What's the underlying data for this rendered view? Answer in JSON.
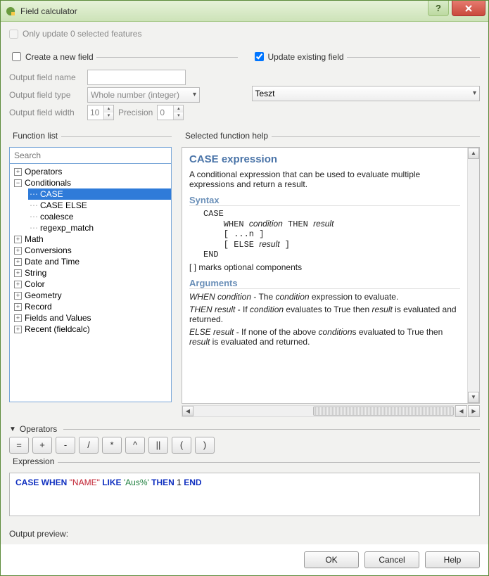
{
  "window": {
    "title": "Field calculator"
  },
  "checkboxes": {
    "only_update": "Only update 0 selected features",
    "create_new_field": "Create a new field",
    "update_existing_field": "Update existing field"
  },
  "form": {
    "output_name_label": "Output field name",
    "output_type_label": "Output field type",
    "output_type_value": "Whole number (integer)",
    "output_width_label": "Output field width",
    "output_width_value": "10",
    "precision_label": "Precision",
    "precision_value": "0",
    "existing_field_value": "Teszt"
  },
  "sections": {
    "function_list": "Function list",
    "selected_help": "Selected function help",
    "operators": "Operators",
    "expression": "Expression",
    "output_preview": "Output preview:"
  },
  "search_placeholder": "Search",
  "tree": {
    "top": [
      "Operators",
      "Conditionals",
      "Math",
      "Conversions",
      "Date and Time",
      "String",
      "Color",
      "Geometry",
      "Record",
      "Fields and Values",
      "Recent (fieldcalc)"
    ],
    "conditionals_children": [
      "CASE",
      "CASE ELSE",
      "coalesce",
      "regexp_match"
    ],
    "selected": "CASE"
  },
  "help": {
    "title": "CASE expression",
    "intro": "A conditional expression that can be used to evaluate multiple expressions and return a result.",
    "syntax_h": "Syntax",
    "syntax_lines": [
      "CASE",
      "    WHEN condition THEN result",
      "    [ ...n ]",
      "    [ ELSE result ]",
      "END"
    ],
    "marks": "[ ] marks optional components",
    "args_h": "Arguments",
    "arg_lines": [
      "WHEN condition - The condition expression to evaluate.",
      "THEN result - If condition evaluates to True then result is evaluated and returned.",
      "ELSE result - If none of the above conditions evaluated to True then result is evaluated and returned."
    ]
  },
  "op_buttons": [
    "=",
    "+",
    "-",
    "/",
    "*",
    "^",
    "||",
    "(",
    ")"
  ],
  "expression_parts": {
    "p1": "CASE WHEN ",
    "p2": "\"NAME\"",
    "p3": " LIKE ",
    "p4": "'Aus%'",
    "p5": " THEN ",
    "p6": "1",
    "p7": " END"
  },
  "buttons": {
    "ok": "OK",
    "cancel": "Cancel",
    "help": "Help"
  }
}
